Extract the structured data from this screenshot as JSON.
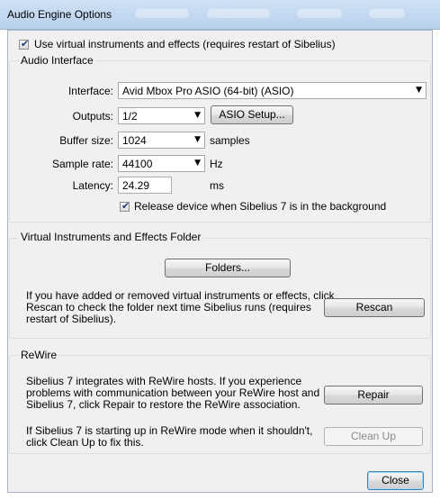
{
  "window": {
    "title": "Audio Engine Options"
  },
  "use_virtual": {
    "checked": true,
    "label": "Use virtual instruments and effects (requires restart of Sibelius)"
  },
  "audio_interface": {
    "group_label": "Audio Interface",
    "interface_label": "Interface:",
    "interface_value": "Avid Mbox Pro ASIO (64-bit) (ASIO)",
    "outputs_label": "Outputs:",
    "outputs_value": "1/2",
    "asio_setup_label": "ASIO Setup...",
    "buffer_label": "Buffer size:",
    "buffer_value": "1024",
    "buffer_unit": "samples",
    "sample_rate_label": "Sample rate:",
    "sample_rate_value": "44100",
    "sample_rate_unit": "Hz",
    "latency_label": "Latency:",
    "latency_value": "24.29",
    "latency_unit": "ms",
    "release_checked": true,
    "release_label": "Release device when Sibelius 7 is in the background"
  },
  "vi_folder": {
    "group_label": "Virtual Instruments and Effects Folder",
    "folders_label": "Folders...",
    "rescan_text_1": "If you have added or removed virtual instruments or effects, click",
    "rescan_text_2": "Rescan to check the folder next time Sibelius runs (requires",
    "rescan_text_3": "restart of Sibelius).",
    "rescan_label": "Rescan"
  },
  "rewire": {
    "group_label": "ReWire",
    "repair_text_1": "Sibelius 7 integrates with ReWire hosts. If you experience",
    "repair_text_2": "problems with communication between your ReWire host and",
    "repair_text_3": "Sibelius 7, click Repair to restore the ReWire association.",
    "repair_label": "Repair",
    "cleanup_text_1": "If Sibelius 7 is starting up in ReWire mode when it shouldn't,",
    "cleanup_text_2": "click Clean Up to fix this.",
    "cleanup_label": "Clean Up"
  },
  "footer": {
    "close_label": "Close"
  },
  "icons": {
    "checkmark": "✔",
    "dropdown_arrow": "▼"
  }
}
